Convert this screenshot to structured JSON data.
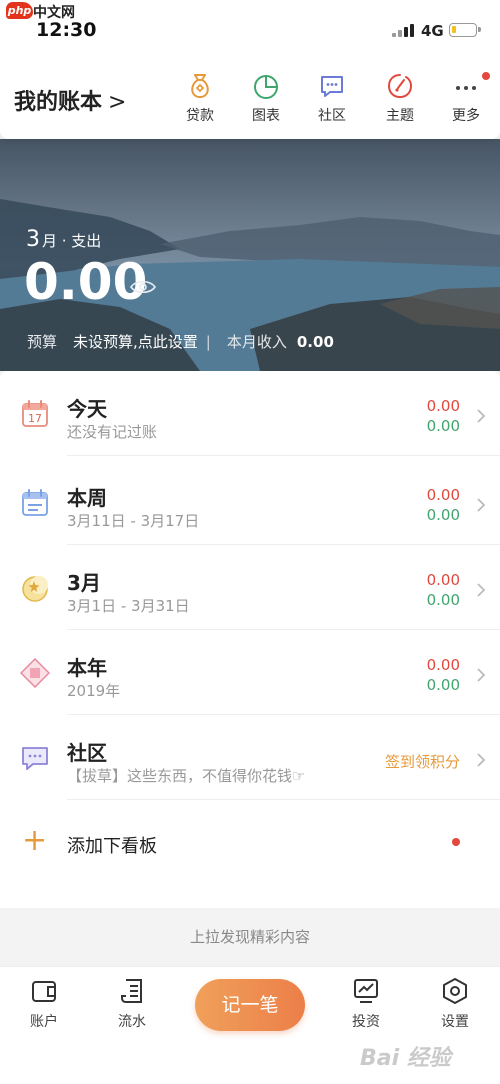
{
  "status_bar": {
    "watermark_logo": "php",
    "watermark_text": "中文网",
    "time": "12:30",
    "network": "4G",
    "battery_level": 0.2
  },
  "header": {
    "title": "我的账本",
    "nav": [
      {
        "label": "贷款",
        "icon": "loan-bag-icon",
        "color": "#e79a3c"
      },
      {
        "label": "图表",
        "icon": "pie-chart-icon",
        "color": "#3fa56d"
      },
      {
        "label": "社区",
        "icon": "chat-bubble-icon",
        "color": "#6b7bd6"
      },
      {
        "label": "主题",
        "icon": "theme-icon",
        "color": "#e2483d"
      },
      {
        "label": "更多",
        "icon": "more-icon",
        "color": "#444444"
      }
    ]
  },
  "banner": {
    "month_num": "3",
    "month_suffix": "月 · 支出",
    "amount": "0.00",
    "budget_label": "预算",
    "budget_value": "未设预算,点此设置",
    "separator": "|",
    "income_label": "本月收入",
    "income_value": "0.00"
  },
  "list": [
    {
      "title": "今天",
      "sub": "还没有记过账",
      "expense": "0.00",
      "income": "0.00",
      "icon": "calendar-17-icon",
      "icon_text": "17"
    },
    {
      "title": "本周",
      "sub": "3月11日 - 3月17日",
      "expense": "0.00",
      "income": "0.00",
      "icon": "week-calendar-icon"
    },
    {
      "title": "3月",
      "sub": "3月1日 - 3月31日",
      "expense": "0.00",
      "income": "0.00",
      "icon": "moon-icon"
    },
    {
      "title": "本年",
      "sub": "2019年",
      "expense": "0.00",
      "income": "0.00",
      "icon": "diamond-icon"
    },
    {
      "title": "社区",
      "sub": "【拔草】这些东西，不值得你花钱☞",
      "action": "签到领积分",
      "icon": "community-chat-icon"
    }
  ],
  "add_board": {
    "label": "添加下看板",
    "icon": "plus-icon"
  },
  "pull_hint": "上拉发现精彩内容",
  "tabbar": {
    "items": [
      {
        "label": "账户",
        "icon": "wallet-icon"
      },
      {
        "label": "流水",
        "icon": "ledger-icon"
      },
      {
        "label": "投资",
        "icon": "invest-chart-icon"
      },
      {
        "label": "设置",
        "icon": "settings-hex-icon"
      }
    ],
    "record_button": "记一笔"
  },
  "colors": {
    "accent": "#e79a3c",
    "expense": "#e2483d",
    "income": "#3fa56d"
  }
}
